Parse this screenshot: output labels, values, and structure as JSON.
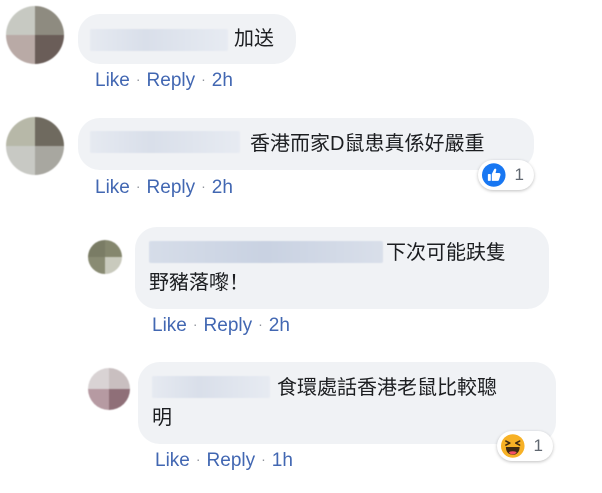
{
  "comments": [
    {
      "text": "加送",
      "actions": {
        "like": "Like",
        "reply": "Reply",
        "time": "2h"
      }
    },
    {
      "text": "香港而家D鼠患真係好嚴重",
      "actions": {
        "like": "Like",
        "reply": "Reply",
        "time": "2h"
      },
      "reaction": {
        "icon": "like-icon",
        "count": "1"
      }
    }
  ],
  "replies": [
    {
      "text_line1": "下次可能趺隻",
      "text_line2": "野豬落嚟！",
      "actions": {
        "like": "Like",
        "reply": "Reply",
        "time": "2h"
      }
    },
    {
      "text_line1": "食環處話香港老鼠比較聰",
      "text_line2": "明",
      "actions": {
        "like": "Like",
        "reply": "Reply",
        "time": "1h"
      },
      "reaction": {
        "icon": "haha-icon",
        "count": "1"
      }
    }
  ],
  "separator": "·",
  "colors": {
    "link": "#4267b2",
    "bubble": "#f0f2f5",
    "like_blue": "#1877f2",
    "haha_yellow": "#f7b125"
  }
}
